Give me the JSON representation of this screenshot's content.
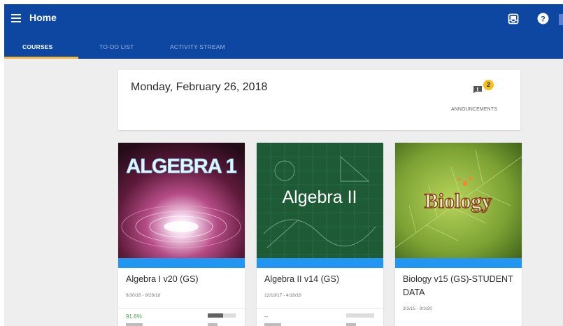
{
  "header": {
    "title": "Home",
    "tabs": [
      {
        "label": "COURSES",
        "active": true
      },
      {
        "label": "TO-DO LIST",
        "active": false
      },
      {
        "label": "ACTIVITY STREAM",
        "active": false
      }
    ]
  },
  "date_card": {
    "date": "Monday, February 26, 2018",
    "announcement_count": "2",
    "announcements_label": "ANNOUNCEMENTS"
  },
  "courses": [
    {
      "image_text": "ALGEBRA 1",
      "name": "Algebra I v20 (GS)",
      "dates": "8/30/16 - 9/28/18",
      "grade": "91.6%",
      "progress": 0.55
    },
    {
      "image_text": "Algebra II",
      "name": "Algebra II v14 (GS)",
      "dates": "12/19/17 - 4/18/18",
      "grade": "--",
      "progress": 0
    },
    {
      "image_text": "Biology",
      "name": "Biology v15 (GS)-STUDENT DATA",
      "dates": "3/3/15 - 9/3/20"
    }
  ],
  "colors": {
    "header_bg": "#0d47a1",
    "tab_underline": "#f4b942",
    "card_stripe": "#2196f3",
    "badge": "#f3c01c",
    "grade": "#43a047"
  }
}
